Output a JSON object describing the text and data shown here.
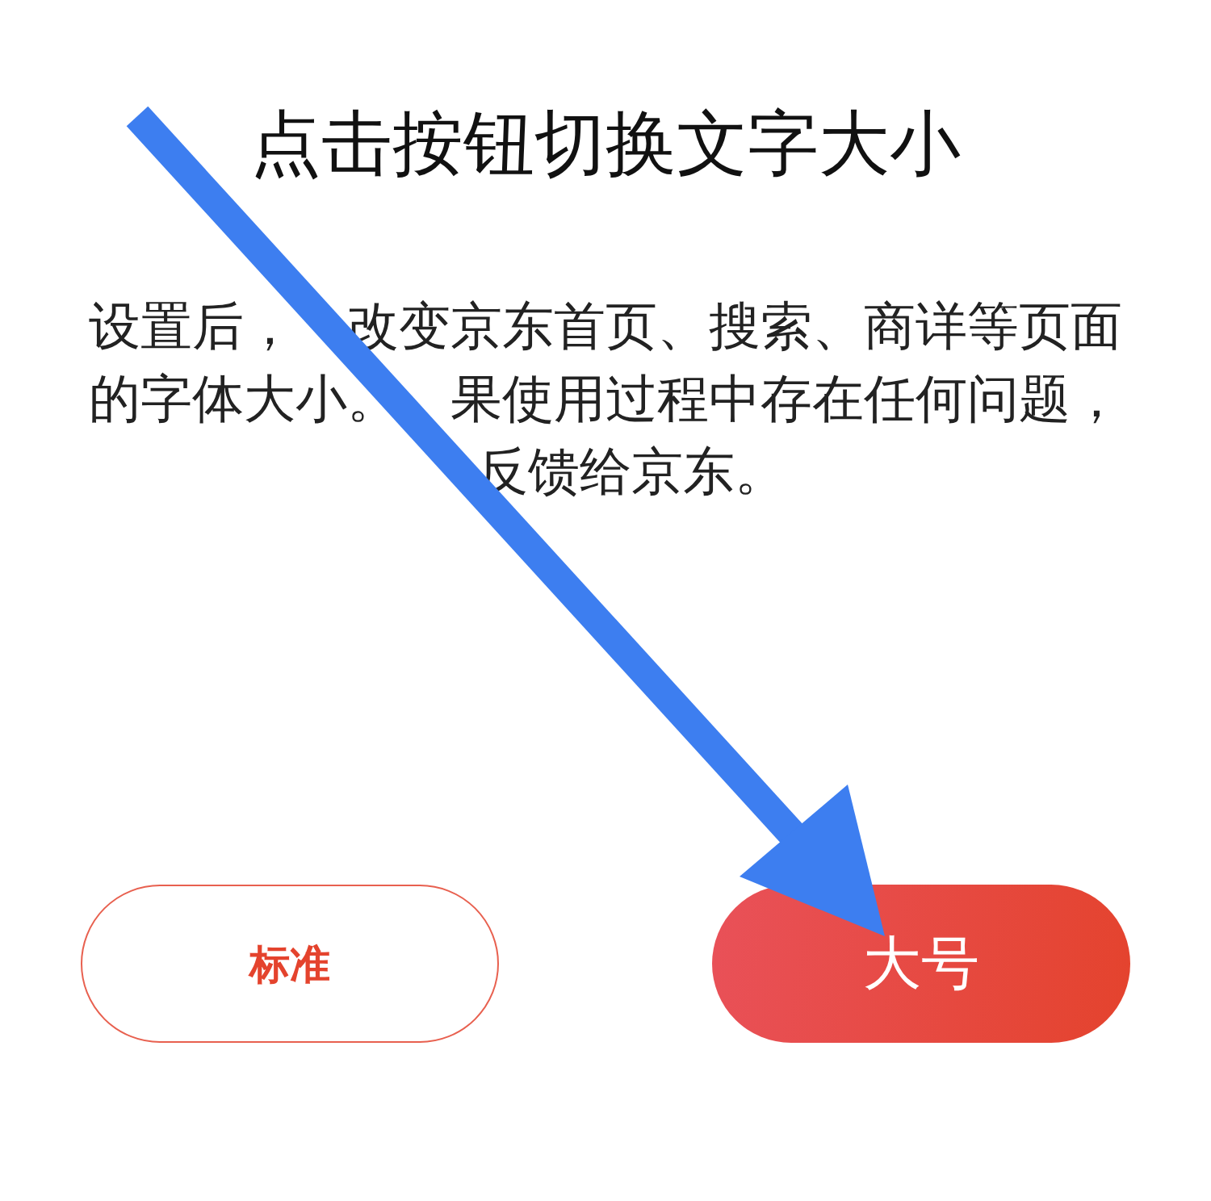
{
  "title": "点击按钮切换文字大小",
  "description_lines": [
    "设置后，　改变京东首页、搜索、商详等页面",
    "的字体大小。　果使用过程中存在任何问题，",
    "　反馈给京东。"
  ],
  "size_options": [
    {
      "label": "标准",
      "selected": false
    },
    {
      "label": "大号",
      "selected": true
    }
  ]
}
